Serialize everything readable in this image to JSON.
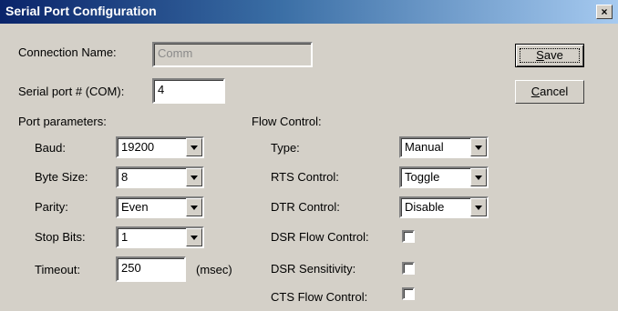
{
  "window": {
    "title": "Serial Port Configuration",
    "close_glyph": "×"
  },
  "connection": {
    "label": "Connection Name:",
    "value": "Comm"
  },
  "com_port": {
    "label": "Serial port # (COM):",
    "value": "4"
  },
  "port_params": {
    "heading": "Port parameters:",
    "baud": {
      "label": "Baud:",
      "value": "19200"
    },
    "byte_size": {
      "label": "Byte Size:",
      "value": "8"
    },
    "parity": {
      "label": "Parity:",
      "value": "Even"
    },
    "stop_bits": {
      "label": "Stop Bits:",
      "value": "1"
    },
    "timeout": {
      "label": "Timeout:",
      "value": "250",
      "unit": "(msec)"
    }
  },
  "flow_control": {
    "heading": "Flow Control:",
    "type": {
      "label": "Type:",
      "value": "Manual"
    },
    "rts": {
      "label": "RTS Control:",
      "value": "Toggle"
    },
    "dtr": {
      "label": "DTR Control:",
      "value": "Disable"
    },
    "dsr_flow": {
      "label": "DSR Flow Control:",
      "checked": false
    },
    "dsr_sensitivity": {
      "label": "DSR Sensitivity:",
      "checked": false
    },
    "cts_flow": {
      "label": "CTS Flow Control:",
      "checked": false
    }
  },
  "buttons": {
    "save": {
      "mnemonic": "S",
      "rest": "ave"
    },
    "cancel": {
      "mnemonic": "C",
      "rest": "ancel"
    }
  }
}
